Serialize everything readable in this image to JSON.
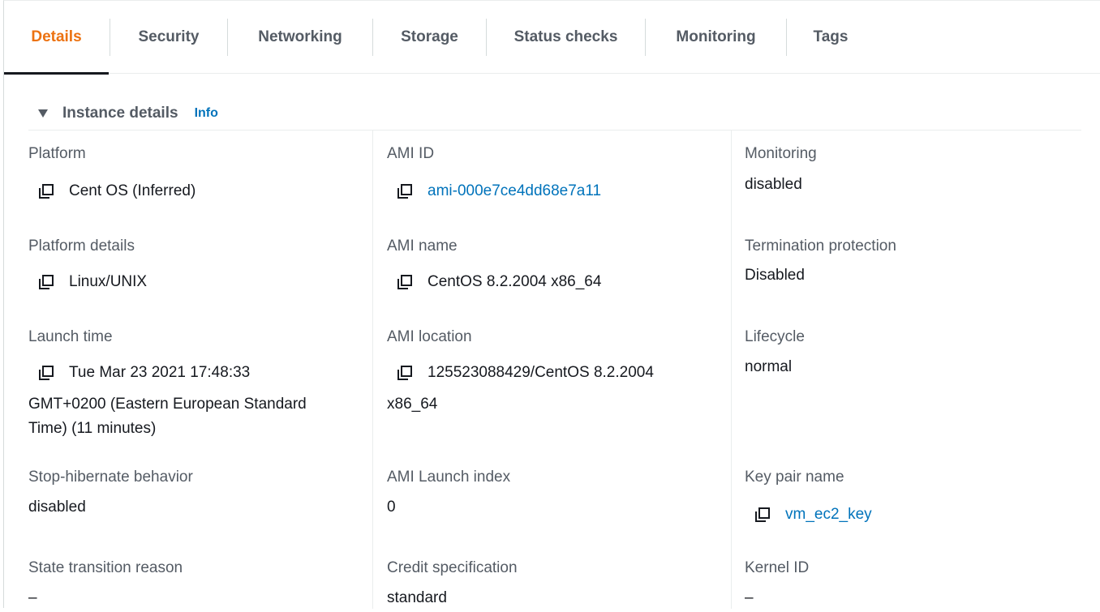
{
  "tabs": [
    {
      "label": "Details",
      "active": true
    },
    {
      "label": "Security"
    },
    {
      "label": "Networking"
    },
    {
      "label": "Storage"
    },
    {
      "label": "Status checks"
    },
    {
      "label": "Monitoring"
    },
    {
      "label": "Tags"
    }
  ],
  "section": {
    "title": "Instance details",
    "info": "Info",
    "caret_icon": "caret-down-icon"
  },
  "colors": {
    "active_tab": "#ec7211",
    "link": "#0073bb",
    "label": "#545b64",
    "text": "#16191f"
  },
  "fields": {
    "platform": {
      "label": "Platform",
      "value": "Cent OS (Inferred)",
      "icon": "copy-icon"
    },
    "platform_details": {
      "label": "Platform details",
      "value": "Linux/UNIX",
      "icon": "copy-icon"
    },
    "launch_time": {
      "label": "Launch time",
      "value_line1": "Tue Mar 23 2021 17:48:33",
      "value_line2": "GMT+0200 (Eastern European Standard",
      "value_line3": "Time) (11 minutes)",
      "icon": "copy-icon"
    },
    "stop_hibernate": {
      "label": "Stop-hibernate behavior",
      "value": "disabled"
    },
    "state_transition": {
      "label": "State transition reason",
      "value": "–"
    },
    "ami_id": {
      "label": "AMI ID",
      "value": "ami-000e7ce4dd68e7a11",
      "icon": "copy-icon"
    },
    "ami_name": {
      "label": "AMI name",
      "value": "CentOS 8.2.2004 x86_64",
      "icon": "copy-icon"
    },
    "ami_location": {
      "label": "AMI location",
      "value_line1": "125523088429/CentOS 8.2.2004",
      "value_line2": "x86_64",
      "icon": "copy-icon"
    },
    "ami_launch_index": {
      "label": "AMI Launch index",
      "value": "0"
    },
    "credit_spec": {
      "label": "Credit specification",
      "value": "standard"
    },
    "monitoring": {
      "label": "Monitoring",
      "value": "disabled"
    },
    "termination_protection": {
      "label": "Termination protection",
      "value": "Disabled"
    },
    "lifecycle": {
      "label": "Lifecycle",
      "value": "normal"
    },
    "key_pair": {
      "label": "Key pair name",
      "value": "vm_ec2_key",
      "icon": "copy-icon"
    },
    "kernel_id": {
      "label": "Kernel ID",
      "value": "–"
    }
  }
}
